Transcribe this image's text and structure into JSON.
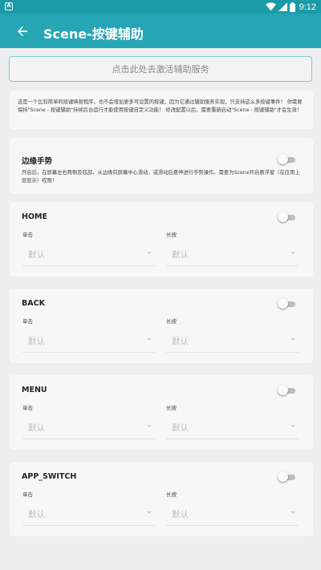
{
  "status_bar": {
    "time": "9:12",
    "notification_icon": "android-notification-icon"
  },
  "app_bar": {
    "title": "Scene-按键辅助",
    "back_icon": "arrow-back-icon"
  },
  "activate_button": "点击此处去激活辅助服务",
  "intro_text": "这是一个比较简单的按键映射程序，也不会增加更多可设置的按键，因为它通过辅助服务实现，只支持这么多按键事件！ 你需要保持\"Scene - 按键辅助\"持续后台运行才能使用按键自定义功能！ 修改配置以后，需要重新启动\"Scene - 按键辅助\"才会生效！",
  "edge_gesture": {
    "title": "边缘手势",
    "enabled": false,
    "description": "开启后，在屏幕左右两侧及底部，从边缘向屏幕中心滑动，或滑动后悬停进行手势操作。需要为Scene开启悬浮窗（在应用上层显示）权限！"
  },
  "keys": [
    {
      "name": "HOME",
      "enabled": false,
      "tap_label": "单击",
      "tap_value": "默认",
      "long_label": "长按",
      "long_value": "默认"
    },
    {
      "name": "BACK",
      "enabled": false,
      "tap_label": "单击",
      "tap_value": "默认",
      "long_label": "长按",
      "long_value": "默认"
    },
    {
      "name": "MENU",
      "enabled": false,
      "tap_label": "单击",
      "tap_value": "默认",
      "long_label": "长按",
      "long_value": "默认"
    },
    {
      "name": "APP_SWITCH",
      "enabled": false,
      "tap_label": "单击",
      "tap_value": "默认",
      "long_label": "长按",
      "long_value": "默认"
    }
  ],
  "colors": {
    "status_bar": "#1b9aa7",
    "app_bar": "#26a6b5",
    "background": "#eeeeee",
    "card": "#f7f7f7"
  }
}
